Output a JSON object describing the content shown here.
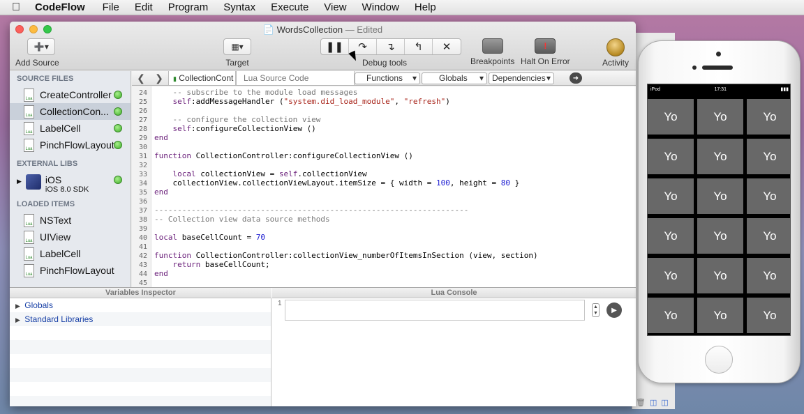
{
  "menubar": {
    "app_name": "CodeFlow",
    "items": [
      "File",
      "Edit",
      "Program",
      "Syntax",
      "Execute",
      "View",
      "Window",
      "Help"
    ]
  },
  "window": {
    "title": "WordsCollection",
    "edited": "— Edited"
  },
  "toolbar": {
    "add_source": "Add Source",
    "target": "Target",
    "debug_tools": "Debug tools",
    "breakpoints": "Breakpoints",
    "halt_on_error": "Halt On Error",
    "activity": "Activity"
  },
  "sidebar": {
    "source_files_header": "SOURCE FILES",
    "source_files": [
      "CreateController",
      "CollectionCon...",
      "LabelCell",
      "PinchFlowLayout"
    ],
    "external_libs_header": "EXTERNAL LIBS",
    "ios_name": "iOS",
    "ios_sdk": "iOS 8.0 SDK",
    "loaded_items_header": "LOADED ITEMS",
    "loaded_items": [
      "NSText",
      "UIView",
      "LabelCell",
      "PinchFlowLayout"
    ]
  },
  "editor_toolbar": {
    "tab_active": "CollectionCont",
    "tab_lua": "Lua Source Code",
    "functions": "Functions",
    "globals": "Globals",
    "dependencies": "Dependencies"
  },
  "code_lines": [
    {
      "n": "24",
      "t": "    -- subscribe to the module load messages"
    },
    {
      "n": "25",
      "t": "    self:addMessageHandler (\"system.did_load_module\", \"refresh\")"
    },
    {
      "n": "26",
      "t": ""
    },
    {
      "n": "27",
      "t": "    -- configure the collection view"
    },
    {
      "n": "28",
      "t": "    self:configureCollectionView ()"
    },
    {
      "n": "29",
      "t": "end"
    },
    {
      "n": "30",
      "t": ""
    },
    {
      "n": "31",
      "t": "function CollectionController:configureCollectionView ()"
    },
    {
      "n": "32",
      "t": ""
    },
    {
      "n": "33",
      "t": "    local collectionView = self.collectionView"
    },
    {
      "n": "34",
      "t": "    collectionView.collectionViewLayout.itemSize = { width = 100, height = 80 }"
    },
    {
      "n": "35",
      "t": "end"
    },
    {
      "n": "36",
      "t": ""
    },
    {
      "n": "37",
      "t": "--------------------------------------------------------------------"
    },
    {
      "n": "38",
      "t": "-- Collection view data source methods"
    },
    {
      "n": "39",
      "t": ""
    },
    {
      "n": "40",
      "t": "local baseCellCount = 70"
    },
    {
      "n": "41",
      "t": ""
    },
    {
      "n": "42",
      "t": "function CollectionController:collectionView_numberOfItemsInSection (view, section)"
    },
    {
      "n": "43",
      "t": "    return baseCellCount;"
    },
    {
      "n": "44",
      "t": "end"
    },
    {
      "n": "45",
      "t": ""
    }
  ],
  "variables_inspector": {
    "header": "Variables Inspector",
    "rows": [
      "Globals",
      "Standard Libraries"
    ]
  },
  "lua_console": {
    "header": "Lua Console",
    "line_number": "1"
  },
  "phone": {
    "carrier": "iPod",
    "time": "17:31",
    "cell_label": "Yo",
    "cell_count": 18
  },
  "colors": {
    "keyword": "#6a1f7a",
    "method": "#3a75a8",
    "string": "#a8241a",
    "comment": "#777777",
    "number": "#1b1bd1",
    "status_dot": "#3fae28"
  }
}
